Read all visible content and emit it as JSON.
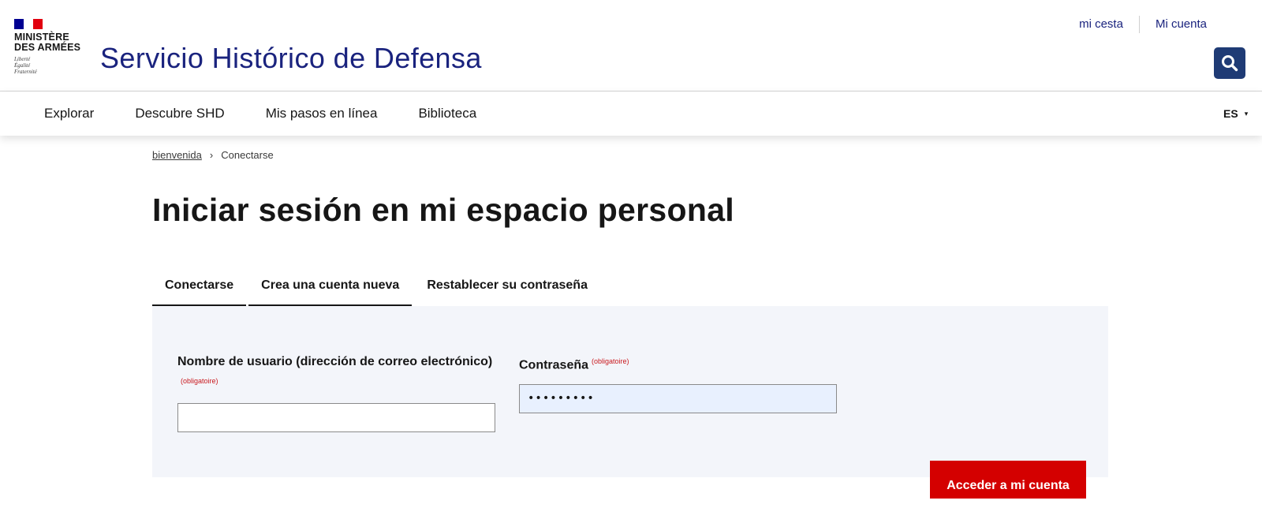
{
  "header": {
    "logo": {
      "ministry_name": "MINISTÈRE\nDES ARMÉES",
      "motto": "Liberté\nÉgalité\nFraternité",
      "flag_colors": [
        "#000091",
        "#ffffff",
        "#e1000f"
      ]
    },
    "site_title": "Servicio Histórico de Defensa",
    "top_links": {
      "cart": "mi cesta",
      "account": "Mi cuenta"
    },
    "search_icon": "search-icon",
    "accent_color": "#1f3b75"
  },
  "nav": {
    "items": [
      "Explorar",
      "Descubre SHD",
      "Mis pasos en línea",
      "Biblioteca"
    ],
    "language": "ES",
    "language_caret": "▾"
  },
  "breadcrumb": {
    "home": "bienvenida",
    "separator": "›",
    "current": "Conectarse"
  },
  "page_title": "Iniciar sesión en mi espacio personal",
  "tabs": [
    "Conectarse",
    "Crea una cuenta nueva",
    "Restablecer su contraseña"
  ],
  "form": {
    "username_label": "Nombre de usuario (dirección de correo electrónico)",
    "username_required": "(obligatoire)",
    "username_value": "",
    "password_label": "Contraseña",
    "password_required": "(obligatoire)",
    "password_value": "•••••••••",
    "submit_label": "Acceder a mi cuenta",
    "submit_color": "#d40000"
  }
}
